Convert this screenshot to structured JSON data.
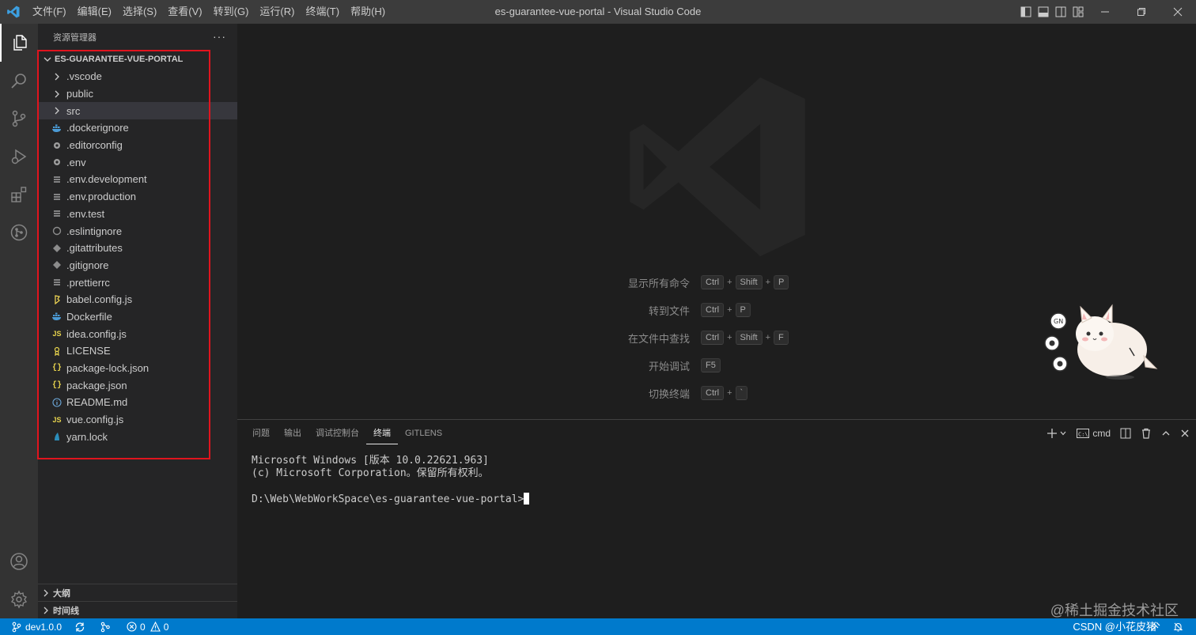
{
  "window": {
    "title": "es-guarantee-vue-portal - Visual Studio Code"
  },
  "menu": [
    "文件(F)",
    "编辑(E)",
    "选择(S)",
    "查看(V)",
    "转到(G)",
    "运行(R)",
    "终端(T)",
    "帮助(H)"
  ],
  "sidebar": {
    "title": "资源管理器",
    "more": "···",
    "folder": "ES-GUARANTEE-VUE-PORTAL",
    "items": [
      {
        "label": ".vscode",
        "icon": "chevron-right-icon"
      },
      {
        "label": "public",
        "icon": "chevron-right-icon"
      },
      {
        "label": "src",
        "icon": "chevron-right-icon"
      },
      {
        "label": ".dockerignore",
        "icon": "docker-icon"
      },
      {
        "label": ".editorconfig",
        "icon": "gear-icon"
      },
      {
        "label": ".env",
        "icon": "gear-icon"
      },
      {
        "label": ".env.development",
        "icon": "lines-icon"
      },
      {
        "label": ".env.production",
        "icon": "lines-icon"
      },
      {
        "label": ".env.test",
        "icon": "lines-icon"
      },
      {
        "label": ".eslintignore",
        "icon": "eslint-icon"
      },
      {
        "label": ".gitattributes",
        "icon": "git-icon"
      },
      {
        "label": ".gitignore",
        "icon": "git-icon"
      },
      {
        "label": ".prettierrc",
        "icon": "lines-icon"
      },
      {
        "label": "babel.config.js",
        "icon": "babel-icon"
      },
      {
        "label": "Dockerfile",
        "icon": "docker-icon"
      },
      {
        "label": "idea.config.js",
        "icon": "js-icon"
      },
      {
        "label": "LICENSE",
        "icon": "license-icon"
      },
      {
        "label": "package-lock.json",
        "icon": "json-icon"
      },
      {
        "label": "package.json",
        "icon": "json-icon"
      },
      {
        "label": "README.md",
        "icon": "info-icon"
      },
      {
        "label": "vue.config.js",
        "icon": "js-icon"
      },
      {
        "label": "yarn.lock",
        "icon": "yarn-icon"
      }
    ],
    "outline": "大纲",
    "timeline": "时间线"
  },
  "editor": {
    "shortcuts": [
      {
        "label": "显示所有命令",
        "keys": [
          "Ctrl",
          "Shift",
          "P"
        ]
      },
      {
        "label": "转到文件",
        "keys": [
          "Ctrl",
          "P"
        ]
      },
      {
        "label": "在文件中查找",
        "keys": [
          "Ctrl",
          "Shift",
          "F"
        ]
      },
      {
        "label": "开始调试",
        "keys": [
          "F5"
        ]
      },
      {
        "label": "切换终端",
        "keys": [
          "Ctrl",
          "`"
        ]
      }
    ]
  },
  "panel": {
    "tabs": [
      "问题",
      "输出",
      "调试控制台",
      "终端",
      "GITLENS"
    ],
    "active_tab": "终端",
    "shell": "cmd",
    "terminal_lines": [
      "Microsoft Windows [版本 10.0.22621.963]",
      "(c) Microsoft Corporation。保留所有权利。",
      "",
      "D:\\Web\\WebWorkSpace\\es-guarantee-vue-portal>"
    ]
  },
  "status": {
    "branch": "dev1.0.0",
    "errors": "0",
    "warnings": "0"
  },
  "watermarks": {
    "juejin": "@稀土掘金技术社区",
    "csdn": "CSDN @小花皮猪"
  },
  "colors": {
    "accent": "#007acc",
    "highlight": "#e0141e"
  }
}
